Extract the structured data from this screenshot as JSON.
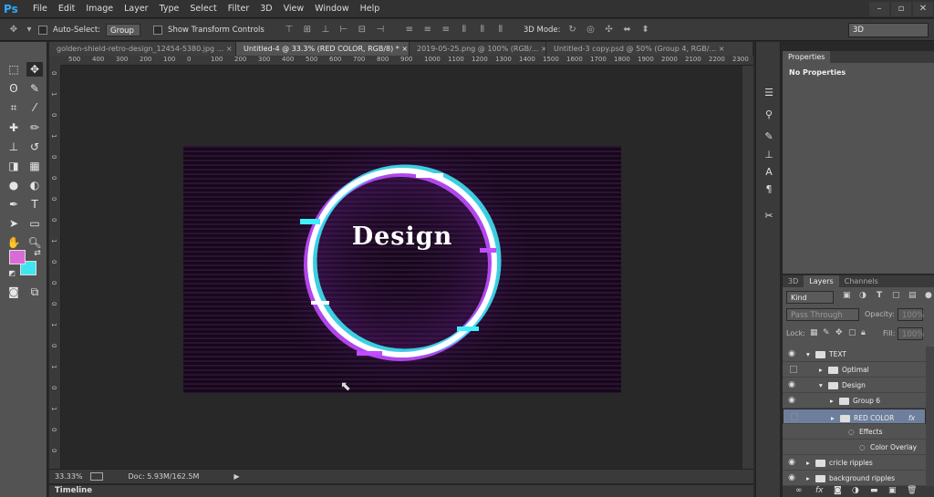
{
  "app": {
    "logo": "Ps"
  },
  "menu": [
    "File",
    "Edit",
    "Image",
    "Layer",
    "Type",
    "Select",
    "Filter",
    "3D",
    "View",
    "Window",
    "Help"
  ],
  "window_controls": [
    "–",
    "▫",
    "✕"
  ],
  "options": {
    "auto_select": "Auto-Select:",
    "group_value": "Group",
    "show_transform": "Show Transform Controls",
    "mode_3d": "3D Mode:",
    "workspace": "3D"
  },
  "tabs": [
    {
      "label": "golden-shield-retro-design_12454-5380.jpg ...",
      "close": "×"
    },
    {
      "label": "Untitled-4 @ 33.3% (RED COLOR, RGB/8) *",
      "close": "×"
    },
    {
      "label": "2019-05-25.png @ 100% (RGB/...",
      "close": "×"
    },
    {
      "label": "Untitled-3 copy.psd @ 50% (Group 4, RGB/...",
      "close": "×"
    }
  ],
  "ruler_top": [
    "500",
    "400",
    "300",
    "200",
    "100",
    "0",
    "100",
    "200",
    "300",
    "400",
    "500",
    "600",
    "700",
    "800",
    "900",
    "1000",
    "1100",
    "1200",
    "1300",
    "1400",
    "1500",
    "1600",
    "1700",
    "1800",
    "1900",
    "2000",
    "2100",
    "2200",
    "2300"
  ],
  "ruler_left": [
    "0",
    "1",
    "0",
    "1",
    "0",
    "0",
    "0",
    "0",
    "1",
    "0",
    "0",
    "0",
    "1",
    "0",
    "1",
    "0",
    "1",
    "0",
    "0"
  ],
  "artboard": {
    "text": "Design"
  },
  "status": {
    "zoom": "33.33%",
    "doc": "Doc: 5.93M/162.5M"
  },
  "timeline": "Timeline",
  "properties": {
    "tab": "Properties",
    "text": "No Properties"
  },
  "layers_panel": {
    "tabs": [
      "3D",
      "Layers",
      "Channels"
    ],
    "kind": "Kind",
    "blend": "Pass Through",
    "opacity_label": "Opacity:",
    "opacity_value": "100%",
    "lock_label": "Lock:",
    "fill_label": "Fill:",
    "fill_value": "100%",
    "rows": [
      {
        "name": "TEXT",
        "visible": true,
        "type": "folder-open",
        "indent": 0
      },
      {
        "name": "Optimal",
        "visible": false,
        "type": "folder",
        "indent": 1
      },
      {
        "name": "Design",
        "visible": true,
        "type": "folder-open",
        "indent": 1
      },
      {
        "name": "Group 6",
        "visible": true,
        "type": "folder",
        "indent": 2
      },
      {
        "name": "RED COLOR",
        "visible": false,
        "type": "folder",
        "indent": 2,
        "selected": true,
        "fx": "fx"
      },
      {
        "name": "Effects",
        "visible": false,
        "type": "effects",
        "indent": 3
      },
      {
        "name": "Color Overlay",
        "visible": false,
        "type": "effect",
        "indent": 4
      },
      {
        "name": "cricle ripples",
        "visible": true,
        "type": "folder",
        "indent": 0
      },
      {
        "name": "background ripples",
        "visible": true,
        "type": "folder",
        "indent": 0
      }
    ],
    "footer": [
      "link",
      "fx",
      "mask",
      "adjust",
      "folder",
      "new",
      "trash"
    ]
  },
  "colors": {
    "foreground": "#d86bd8",
    "background": "#3fe6f0"
  }
}
